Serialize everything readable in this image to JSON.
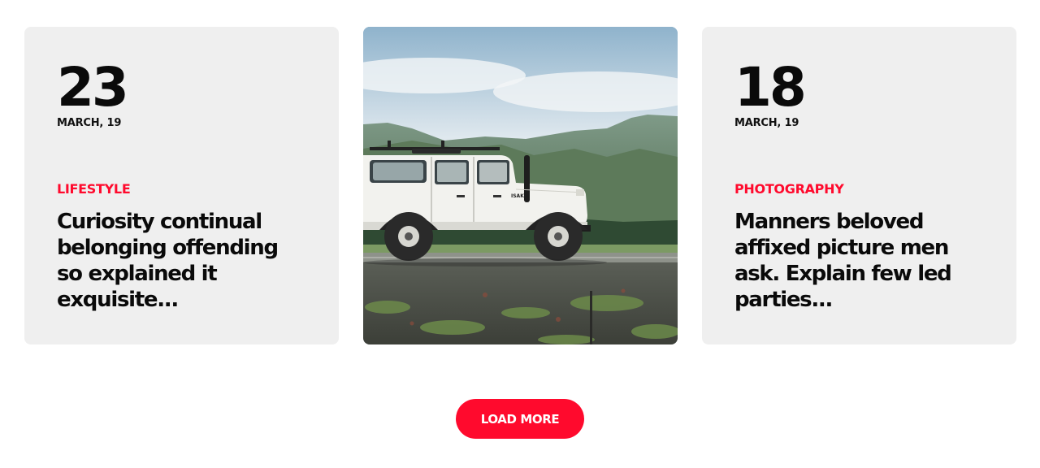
{
  "posts": [
    {
      "day": "23",
      "date": "MARCH, 19",
      "category": "LIFESTYLE",
      "headline": "Curiosity continual belonging offending so explained it exquisite..."
    },
    {
      "image_alt": "white off-road vehicle parked in front of green mountains"
    },
    {
      "day": "18",
      "date": "MARCH, 19",
      "category": "PHOTOGRAPHY",
      "headline": "Manners beloved affixed picture men ask. Explain few led parties..."
    }
  ],
  "load_more_label": "LOAD MORE",
  "colors": {
    "accent": "#ff0a2d",
    "card_bg": "#efefef",
    "text": "#0a0a0a"
  }
}
